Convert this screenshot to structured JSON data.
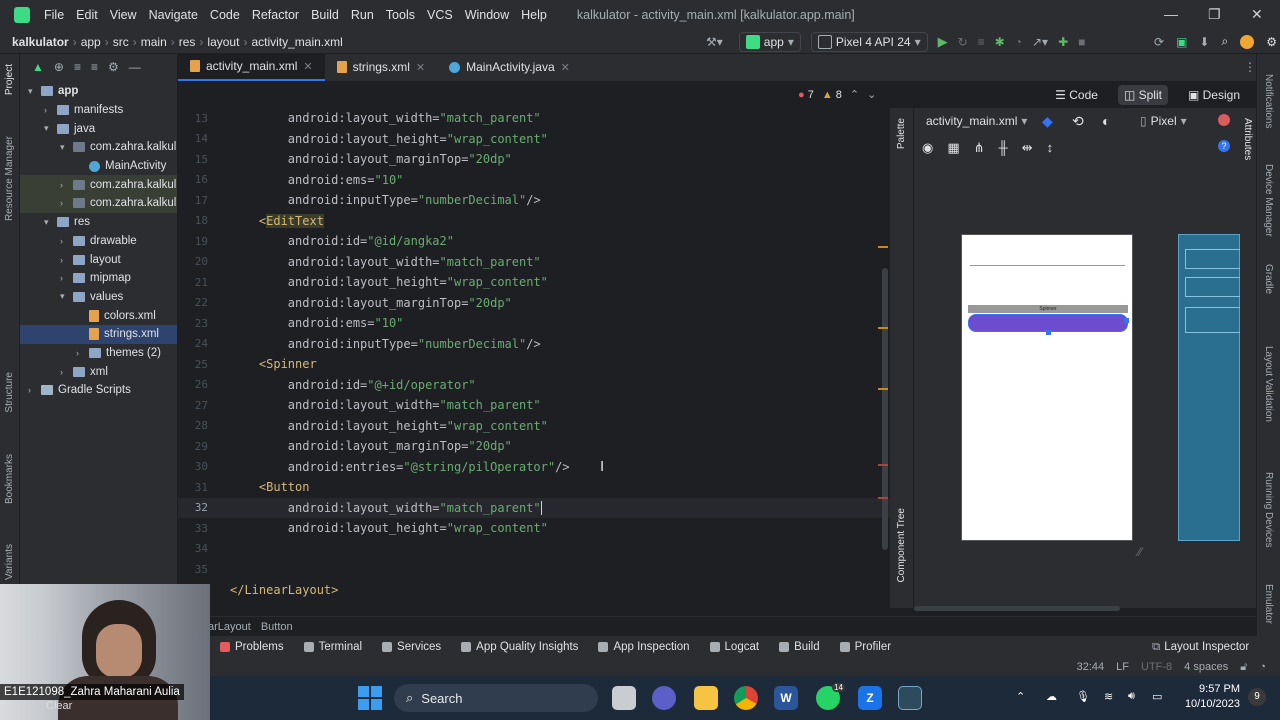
{
  "menubar": {
    "items": [
      "File",
      "Edit",
      "View",
      "Navigate",
      "Code",
      "Refactor",
      "Build",
      "Run",
      "Tools",
      "VCS",
      "Window",
      "Help"
    ],
    "window_title": "kalkulator - activity_main.xml [kalkulator.app.main]"
  },
  "navbar": {
    "breadcrumbs": [
      "kalkulator",
      "app",
      "src",
      "main",
      "res",
      "layout",
      "activity_main.xml"
    ],
    "run_config": "app",
    "device": "Pixel 4 API 24"
  },
  "project_tree": [
    {
      "label": "app",
      "depth": 0,
      "icon": "folder",
      "expanded": true
    },
    {
      "label": "manifests",
      "depth": 1,
      "icon": "folder",
      "expanded": false
    },
    {
      "label": "java",
      "depth": 1,
      "icon": "folder",
      "expanded": true
    },
    {
      "label": "com.zahra.kalkul",
      "depth": 2,
      "icon": "package",
      "expanded": true
    },
    {
      "label": "MainActivity",
      "depth": 3,
      "icon": "class"
    },
    {
      "label": "com.zahra.kalkul",
      "depth": 2,
      "icon": "package",
      "expanded": false
    },
    {
      "label": "com.zahra.kalkul",
      "depth": 2,
      "icon": "package",
      "expanded": false
    },
    {
      "label": "res",
      "depth": 1,
      "icon": "folder",
      "expanded": true
    },
    {
      "label": "drawable",
      "depth": 2,
      "icon": "folder",
      "expanded": false
    },
    {
      "label": "layout",
      "depth": 2,
      "icon": "folder",
      "expanded": false
    },
    {
      "label": "mipmap",
      "depth": 2,
      "icon": "folder",
      "expanded": false
    },
    {
      "label": "values",
      "depth": 2,
      "icon": "folder",
      "expanded": true
    },
    {
      "label": "colors.xml",
      "depth": 3,
      "icon": "xml"
    },
    {
      "label": "strings.xml",
      "depth": 3,
      "icon": "xml",
      "selected": true
    },
    {
      "label": "themes (2)",
      "depth": 3,
      "icon": "folder",
      "expanded": false
    },
    {
      "label": "xml",
      "depth": 2,
      "icon": "folder",
      "expanded": false
    },
    {
      "label": "Gradle Scripts",
      "depth": 0,
      "icon": "gradle",
      "expanded": false
    }
  ],
  "left_strip": [
    "Project",
    "Resource Manager",
    "Structure",
    "Bookmarks",
    "Variants"
  ],
  "tabs": [
    {
      "label": "activity_main.xml",
      "active": true
    },
    {
      "label": "strings.xml",
      "active": false
    },
    {
      "label": "MainActivity.java",
      "active": false
    }
  ],
  "inspection": {
    "errors": "7",
    "warnings": "8"
  },
  "code_lines": [
    {
      "n": "13",
      "parts": [
        [
          "attr",
          "        android:layout_width="
        ],
        [
          "val",
          "\"match_parent\""
        ]
      ]
    },
    {
      "n": "14",
      "parts": [
        [
          "attr",
          "        android:layout_height="
        ],
        [
          "val",
          "\"wrap_content\""
        ]
      ]
    },
    {
      "n": "15",
      "parts": [
        [
          "attr",
          "        android:layout_marginTop="
        ],
        [
          "val",
          "\"20dp\""
        ]
      ]
    },
    {
      "n": "16",
      "parts": [
        [
          "attr",
          "        android:ems="
        ],
        [
          "val",
          "\"10\""
        ]
      ]
    },
    {
      "n": "17",
      "parts": [
        [
          "attr",
          "        android:inputType="
        ],
        [
          "val",
          "\"numberDecimal\""
        ],
        [
          "code",
          "/>"
        ]
      ]
    },
    {
      "n": "18",
      "parts": [
        [
          "tag",
          "    <"
        ],
        [
          "tagbox",
          "EditText"
        ]
      ]
    },
    {
      "n": "19",
      "parts": [
        [
          "attr",
          "        android:id="
        ],
        [
          "val",
          "\"@id/angka2\""
        ]
      ]
    },
    {
      "n": "20",
      "parts": [
        [
          "attr",
          "        android:layout_width="
        ],
        [
          "val",
          "\"match_parent\""
        ]
      ]
    },
    {
      "n": "21",
      "parts": [
        [
          "attr",
          "        android:layout_height="
        ],
        [
          "val",
          "\"wrap_content\""
        ]
      ]
    },
    {
      "n": "22",
      "parts": [
        [
          "attr",
          "        android:layout_marginTop="
        ],
        [
          "val",
          "\"20dp\""
        ]
      ]
    },
    {
      "n": "23",
      "parts": [
        [
          "attr",
          "        android:ems="
        ],
        [
          "val",
          "\"10\""
        ]
      ]
    },
    {
      "n": "24",
      "parts": [
        [
          "attr",
          "        android:inputType="
        ],
        [
          "val",
          "\"numberDecimal\""
        ],
        [
          "code",
          "/>"
        ]
      ]
    },
    {
      "n": "25",
      "parts": [
        [
          "tag",
          "    <Spinner"
        ]
      ]
    },
    {
      "n": "26",
      "parts": [
        [
          "attr",
          "        android:id="
        ],
        [
          "val",
          "\"@+id/operator\""
        ]
      ]
    },
    {
      "n": "27",
      "parts": [
        [
          "attr",
          "        android:layout_width="
        ],
        [
          "val",
          "\"match_parent\""
        ]
      ]
    },
    {
      "n": "28",
      "parts": [
        [
          "attr",
          "        android:layout_height="
        ],
        [
          "val",
          "\"wrap_content\""
        ]
      ]
    },
    {
      "n": "29",
      "parts": [
        [
          "attr",
          "        android:layout_marginTop="
        ],
        [
          "val",
          "\"20dp\""
        ]
      ]
    },
    {
      "n": "30",
      "parts": [
        [
          "attr",
          "        android:entries="
        ],
        [
          "val",
          "\"@string/pilOperator\""
        ],
        [
          "code",
          "/>"
        ]
      ]
    },
    {
      "n": "31",
      "parts": [
        [
          "tag",
          "    <Button"
        ]
      ]
    },
    {
      "n": "32",
      "parts": [
        [
          "attr",
          "        android:layout_width="
        ],
        [
          "val",
          "\"match_parent\""
        ]
      ],
      "current": true
    },
    {
      "n": "33",
      "parts": [
        [
          "attr",
          "        android:layout_height="
        ],
        [
          "val",
          "\"wrap_content\""
        ]
      ]
    },
    {
      "n": "34",
      "parts": []
    },
    {
      "n": "35",
      "parts": []
    },
    {
      "n": "",
      "parts": [
        [
          "tag",
          "</LinearLayout>"
        ]
      ]
    }
  ],
  "design": {
    "modes": [
      "Code",
      "Split",
      "Design"
    ],
    "active_mode": "Split",
    "file_dropdown": "activity_main.xml",
    "device_dropdown": "Pixel",
    "palette_label": "Palette",
    "component_tree_label": "Component Tree",
    "spinner_label": "Spinner"
  },
  "right_strip": [
    "Notifications",
    "Attributes",
    "Device Manager",
    "Gradle",
    "Layout Validation",
    "Running Devices",
    "Emulator"
  ],
  "breadcrumb_bottom": [
    "arLayout",
    "Button"
  ],
  "bottom_tools": [
    "Problems",
    "Terminal",
    "Services",
    "App Quality Insights",
    "App Inspection",
    "Logcat",
    "Build",
    "Profiler"
  ],
  "layout_inspector": "Layout Inspector",
  "status": {
    "position": "32:44",
    "line_sep": "LF",
    "encoding": "UTF-8",
    "indent": "4 spaces"
  },
  "webcam": {
    "name": "E1E121098_Zahra Maharani Aulia",
    "weather": "Clear"
  },
  "taskbar": {
    "search": "Search",
    "time": "9:57 PM",
    "date": "10/10/2023",
    "notif_count": "9",
    "whatsapp_badge": "14"
  },
  "colors": {
    "accent": "#3574f0",
    "android_green": "#3ddc84",
    "spinner_purple": "#6e4ccf"
  }
}
